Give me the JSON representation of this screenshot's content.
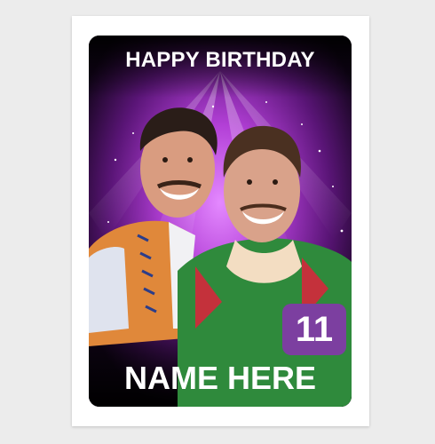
{
  "card": {
    "header_text": "HAPPY BIRTHDAY",
    "name_text": "NAME HERE",
    "age": "11"
  },
  "colors": {
    "background": "#ececec",
    "card": "#ffffff",
    "panel_dark": "#0d0410",
    "stage_purple": "#9b2bbf",
    "badge_purple": "#7c3fa0",
    "text": "#ffffff"
  },
  "icons": {
    "photo": "two-men-portrait-photo"
  }
}
